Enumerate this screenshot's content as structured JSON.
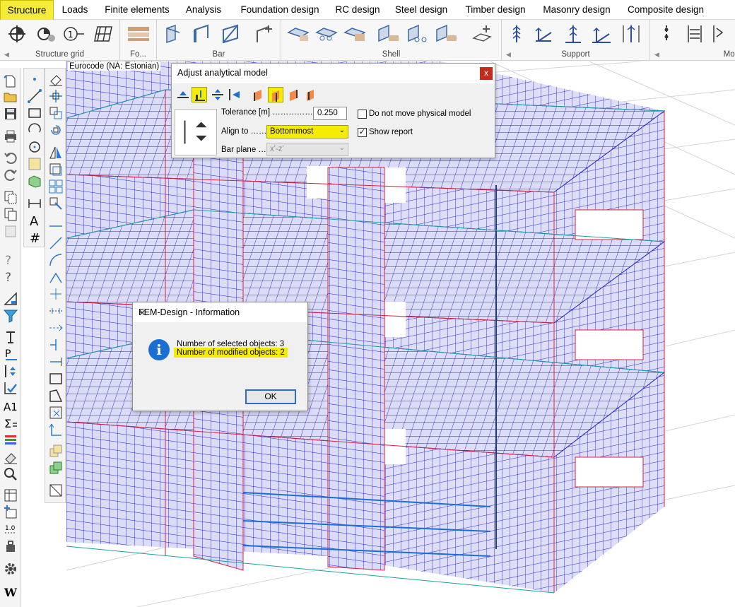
{
  "menu": {
    "tabs": [
      {
        "label": "Structure",
        "active": true
      },
      {
        "label": "Loads"
      },
      {
        "label": "Finite elements"
      },
      {
        "label": "Analysis"
      },
      {
        "label": "Foundation design"
      },
      {
        "label": "RC design"
      },
      {
        "label": "Steel design"
      },
      {
        "label": "Timber design"
      },
      {
        "label": "Masonry design"
      },
      {
        "label": "Composite design"
      }
    ]
  },
  "ribbon": {
    "groups": [
      {
        "label": "Structure grid"
      },
      {
        "label": "Fo..."
      },
      {
        "label": "Bar"
      },
      {
        "label": "Shell"
      },
      {
        "label": "Support"
      },
      {
        "label": "Mod"
      }
    ]
  },
  "viewport": {
    "code_label": "Eurocode (NA: Estonian)"
  },
  "adjust_dialog": {
    "title": "Adjust analytical model",
    "close": "x",
    "tolerance_label": "Tolerance [m] ……………",
    "tolerance_value": "0.250",
    "align_label": "Align to ……",
    "align_value": "Bottommost",
    "bar_plane_label": "Bar plane …",
    "bar_plane_value": "x'-z'",
    "do_not_move_label": "Do not move physical model",
    "show_report_label": "Show report",
    "show_report_checked": "✓"
  },
  "info_dialog": {
    "title": "FEM-Design - Information",
    "close": "✕",
    "line1": "Number of selected objects: 3",
    "line2": "Number of modified objects: 2",
    "ok": "OK",
    "icon": "i"
  },
  "colors": {
    "accent_yellow": "#f5ec00",
    "mesh_blue": "#1c1cd8",
    "shell_fill": "#dcdcf8",
    "edge_red": "#d8203c",
    "info_blue": "#1a6fd4"
  }
}
